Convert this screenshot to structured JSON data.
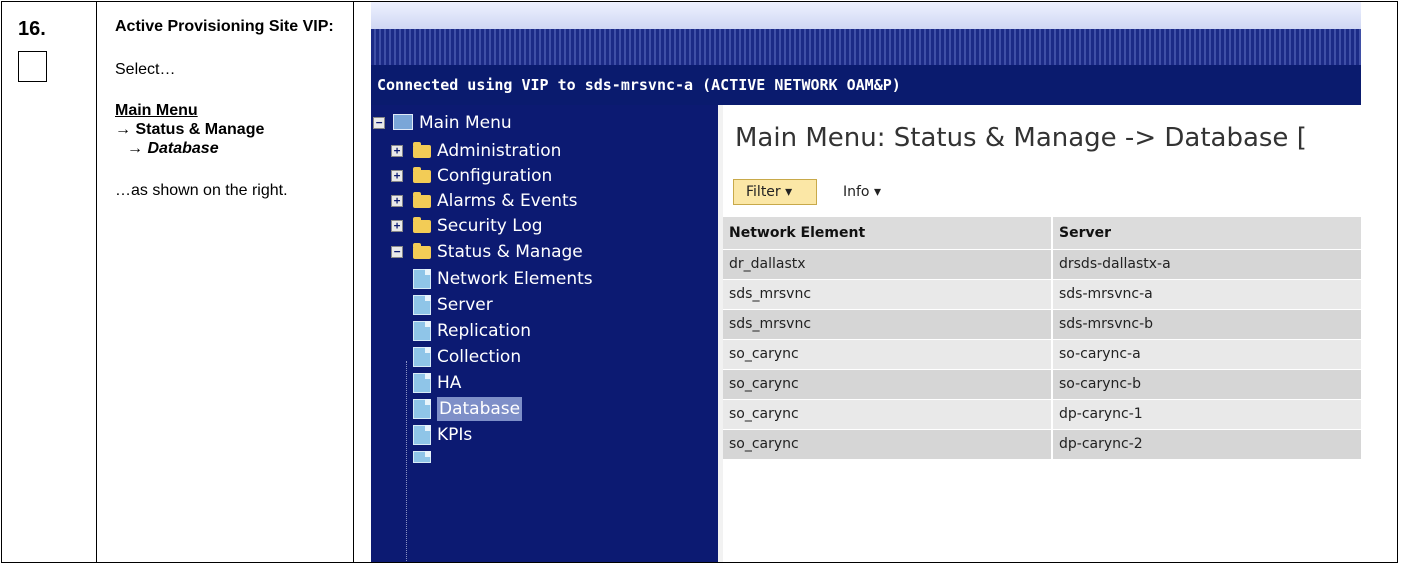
{
  "step": {
    "number": "16."
  },
  "instructions": {
    "title": "Active Provisioning Site VIP:",
    "select": "Select…",
    "menu_root": "Main Menu",
    "menu_path_1": "→ Status & Manage",
    "menu_path_2": "→ Database",
    "shown": "…as shown on the right."
  },
  "screenshot": {
    "connection_text": "Connected using VIP to sds-mrsvnc-a (ACTIVE NETWORK OAM&P)",
    "nav": {
      "root": "Main Menu",
      "items": [
        {
          "label": "Administration"
        },
        {
          "label": "Configuration"
        },
        {
          "label": "Alarms & Events"
        },
        {
          "label": "Security Log"
        },
        {
          "label": "Status & Manage"
        },
        {
          "label": "Network Elements"
        },
        {
          "label": "Server"
        },
        {
          "label": "Replication"
        },
        {
          "label": "Collection"
        },
        {
          "label": "HA"
        },
        {
          "label": "Database"
        },
        {
          "label": "KPIs"
        }
      ]
    },
    "content": {
      "title": "Main Menu: Status & Manage -> Database [",
      "filter_label": "Filter ▾",
      "info_label": "Info ▾",
      "headers": [
        "Network Element",
        "Server"
      ],
      "rows": [
        [
          "dr_dallastx",
          "drsds-dallastx-a"
        ],
        [
          "sds_mrsvnc",
          "sds-mrsvnc-a"
        ],
        [
          "sds_mrsvnc",
          "sds-mrsvnc-b"
        ],
        [
          "so_carync",
          "so-carync-a"
        ],
        [
          "so_carync",
          "so-carync-b"
        ],
        [
          "so_carync",
          "dp-carync-1"
        ],
        [
          "so_carync",
          "dp-carync-2"
        ]
      ]
    },
    "colors": {
      "nav_bg": "#0c1a72",
      "connection_bar": "#0a1b6e",
      "filter_button": "#fbe7a6",
      "row_odd": "#d6d6d6",
      "row_even": "#e9e9e9"
    }
  }
}
